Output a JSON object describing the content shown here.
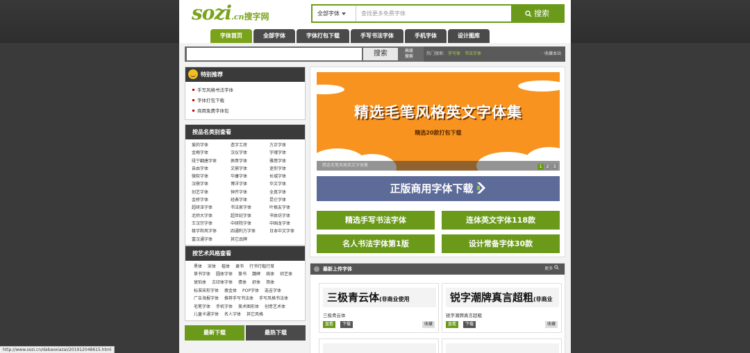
{
  "header": {
    "logo_main": "sozi",
    "logo_cn": ".cn",
    "logo_zh": "搜字网",
    "search_select": "全部字体",
    "search_placeholder": "查找更多免费字体",
    "search_button": "搜索"
  },
  "nav": [
    {
      "label": "字体首页",
      "active": true
    },
    {
      "label": "全部字体"
    },
    {
      "label": "字体打包下载"
    },
    {
      "label": "手写书法字体"
    },
    {
      "label": "手机字体"
    },
    {
      "label": "设计图库"
    }
  ],
  "bar2": {
    "search_button": "搜索",
    "advanced_line1": "高级",
    "advanced_line2": "搜索",
    "hot_label": "热门搜索:",
    "hot_keywords": [
      "手写体",
      "书法字体"
    ],
    "favorite": "· 收藏本站"
  },
  "recommend": {
    "title": "特别推荐",
    "items": [
      "手写风格书法字体",
      "字体打包下载",
      "商用免费字体包"
    ]
  },
  "brand": {
    "title": "按品名类别查看",
    "items": [
      "爱的字体",
      "造字工房",
      "方正字体",
      "金梅字体",
      "汉仪字体",
      "字魂字体",
      "段宁翻唐字体",
      "佩哥字体",
      "雅悠字体",
      "自由字体",
      "文鼎字体",
      "迷你字体",
      "微软字体",
      "华康字体",
      "长城字体",
      "汉鼎字体",
      "博洋字体",
      "华文字体",
      "创艺字体",
      "钟齐字体",
      "全真字体",
      "金桥字体",
      "经典字体",
      "昆仑字体",
      "超研泽字体",
      "书法家字体",
      "叶根友字体",
      "北师大字体",
      "超世纪字体",
      "书体坊字体",
      "王汉宗字体",
      "中研院字体",
      "中国龙字体",
      "极字和风字体",
      "四通利方字体",
      "日本中文字体",
      "富汉通字体",
      "其它品牌"
    ]
  },
  "styles": {
    "title": "按艺术风格查看",
    "items": [
      "黑体",
      "宋体",
      "楷体",
      "隶书",
      "行书行楷行草",
      "草书字体",
      "圆体字体",
      "篆书",
      "魏碑",
      "姚体",
      "综艺体",
      "琥珀体",
      "古印体字体",
      "倩体",
      "舒体",
      "简体",
      "标准宋形字体",
      "瘦金体",
      "POP字体",
      "选吉字体",
      "广告海报字体",
      "推荐手写书法体",
      "手写风格书法体",
      "毛笔字体",
      "手机字体",
      "美术图形体",
      "创意艺术体",
      "儿童卡通字体",
      "名人字体",
      "其它风格"
    ]
  },
  "bottom_tabs": {
    "latest": "最新下载",
    "hot": "最热下载"
  },
  "banner": {
    "title": "精选毛笔风格英文字体集",
    "subtitle": "精选20款打包下载",
    "caption": "精选毛笔风格英文字体集",
    "pages": [
      "1",
      "2",
      "3"
    ],
    "commercial": "正版商用字体下载"
  },
  "quick_buttons": [
    "精选手写书法字体",
    "连体英文字体118款",
    "名人书法字体第1版",
    "设计常备字体30款"
  ],
  "uploads": {
    "title": "最新上传字体",
    "more": "更多",
    "cards": [
      {
        "preview": "三极青云体",
        "preview_small": "(非商业使用",
        "name": "三极青云体",
        "b1": "直看",
        "b2": "下载",
        "b3": "收藏"
      },
      {
        "preview": "锐字潮牌真言超粗",
        "preview_small": "(非商业",
        "name": "锐字潮牌真言超粗",
        "b1": "直看",
        "b2": "下载",
        "b3": "收藏"
      }
    ]
  },
  "status_url": "http://www.sozi.cn/dabaoxiazai/201912048615.html",
  "colors": {
    "green": "#6b9a1b",
    "orange": "#f7931e",
    "blue": "#5d6b99",
    "dark": "#3a3a3a"
  }
}
